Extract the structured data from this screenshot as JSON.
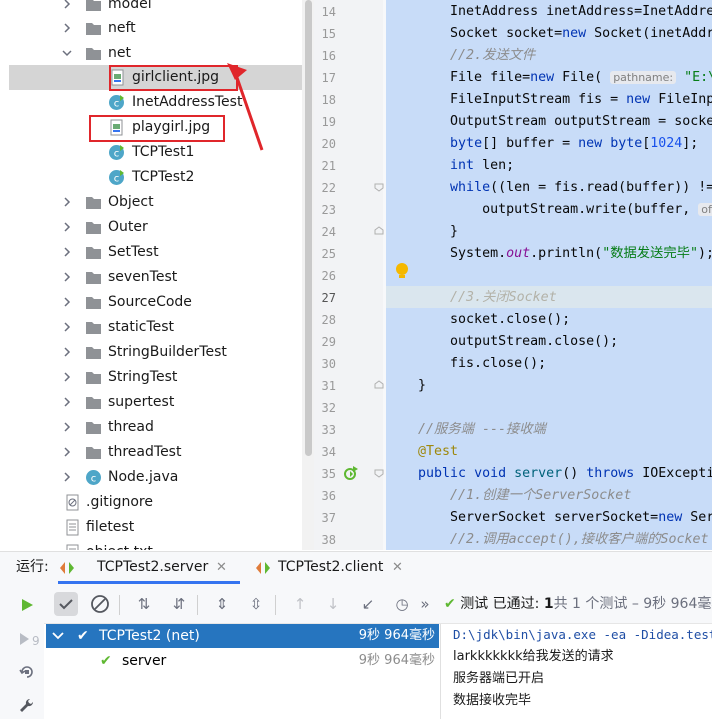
{
  "project_tree": {
    "items": [
      {
        "label": "model",
        "type": "folder",
        "expandable": true
      },
      {
        "label": "neft",
        "type": "folder",
        "expandable": true
      },
      {
        "label": "net",
        "type": "folder",
        "expanded": true
      },
      {
        "label": "girlclient.jpg",
        "type": "image",
        "selected": true
      },
      {
        "label": "InetAddressTest",
        "type": "class"
      },
      {
        "label": "playgirl.jpg",
        "type": "image"
      },
      {
        "label": "TCPTest1",
        "type": "class"
      },
      {
        "label": "TCPTest2",
        "type": "class"
      },
      {
        "label": "Object",
        "type": "folder",
        "expandable": true
      },
      {
        "label": "Outer",
        "type": "folder",
        "expandable": true
      },
      {
        "label": "SetTest",
        "type": "folder",
        "expandable": true
      },
      {
        "label": "sevenTest",
        "type": "folder",
        "expandable": true
      },
      {
        "label": "SourceCode",
        "type": "folder",
        "expandable": true
      },
      {
        "label": "staticTest",
        "type": "folder",
        "expandable": true
      },
      {
        "label": "StringBuilderTest",
        "type": "folder",
        "expandable": true
      },
      {
        "label": "StringTest",
        "type": "folder",
        "expandable": true
      },
      {
        "label": "supertest",
        "type": "folder",
        "expandable": true
      },
      {
        "label": "thread",
        "type": "folder",
        "expandable": true
      },
      {
        "label": "threadTest",
        "type": "folder",
        "expandable": true
      },
      {
        "label": "Node.java",
        "type": "class",
        "expandable": true
      },
      {
        "label": ".gitignore",
        "type": "file"
      },
      {
        "label": "filetest",
        "type": "file"
      },
      {
        "label": "object.txt",
        "type": "file"
      }
    ]
  },
  "editor": {
    "line_numbers": [
      "14",
      "15",
      "16",
      "17",
      "18",
      "19",
      "20",
      "21",
      "22",
      "23",
      "24",
      "25",
      "26",
      "27",
      "28",
      "29",
      "30",
      "31",
      "32",
      "33",
      "34",
      "35",
      "36",
      "37",
      "38"
    ],
    "lines": [
      "        InetAddress inetAddress=InetAddress.",
      "        Socket socket=new Socket(inetAddress",
      "        //2.发送文件",
      "        File file=new File( pathname: \"E:\\\\",
      "        FileInputStream fis = new FileInputStr",
      "        OutputStream outputStream = socket.ge",
      "        byte[] buffer = new byte[1024];",
      "        int len;",
      "        while((len = fis.read(buffer)) !=",
      "            outputStream.write(buffer, off",
      "        }",
      "        System.out.println(\"数据发送完毕\");",
      "",
      "        //3.关闭Socket",
      "        socket.close();",
      "        outputStream.close();",
      "        fis.close();",
      "    }",
      "",
      "    //服务端 ---接收端",
      "    @Test",
      "    public void server() throws IOExceptio",
      "        //1.创建一个ServerSocket",
      "        ServerSocket serverSocket=new Serve",
      "        //2.调用accept(),接收客户端的Socket"
    ]
  },
  "run_panel": {
    "run_label": "运行:",
    "tabs": [
      {
        "label": "TCPTest2.server",
        "active": true
      },
      {
        "label": "TCPTest2.client",
        "active": false
      }
    ],
    "status_prefix": "测试 已通过:",
    "status_count": "1",
    "status_rest": "共 1 个测试 – 9秒 964毫秒",
    "results": [
      {
        "label": "TCPTest2 (net)",
        "time": "9秒 964毫秒",
        "selected": true
      },
      {
        "label": "server",
        "time": "9秒 964毫秒",
        "selected": false
      }
    ],
    "console": [
      "D:\\jdk\\bin\\java.exe -ea -Didea.test",
      "larkkkkkkk给我发送的请求",
      "服务器端已开启",
      "数据接收完毕"
    ]
  },
  "colors": {
    "accent": "#3574f0",
    "annotation_red": "#e0262b",
    "selection_blue": "#2675bf",
    "pass_green": "#5fb832",
    "code_bg": "#c8dcf8"
  }
}
